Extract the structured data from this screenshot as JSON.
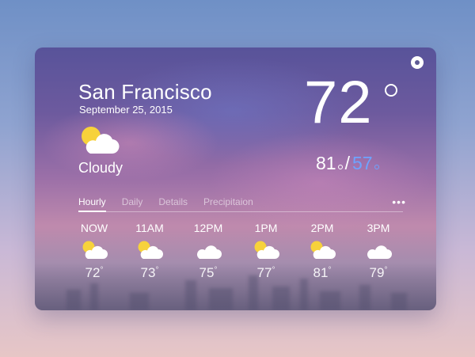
{
  "location": {
    "city": "San Francisco",
    "date": "September 25, 2015"
  },
  "current": {
    "condition": "Cloudy",
    "icon": "partly-cloudy-icon",
    "temperature": "72",
    "high": "81",
    "low": "57"
  },
  "tabs": [
    {
      "label": "Hourly",
      "active": true
    },
    {
      "label": "Daily",
      "active": false
    },
    {
      "label": "Details",
      "active": false
    },
    {
      "label": "Precipitaion",
      "active": false
    }
  ],
  "more_label": "•••",
  "hourly": [
    {
      "time": "NOW",
      "icon": "partly-cloudy-icon",
      "temp": "72"
    },
    {
      "time": "11AM",
      "icon": "partly-cloudy-icon",
      "temp": "73"
    },
    {
      "time": "12PM",
      "icon": "cloud-icon",
      "temp": "75"
    },
    {
      "time": "1PM",
      "icon": "partly-cloudy-icon",
      "temp": "77"
    },
    {
      "time": "2PM",
      "icon": "partly-cloudy-icon",
      "temp": "81"
    },
    {
      "time": "3PM",
      "icon": "cloud-icon",
      "temp": "79"
    }
  ],
  "colors": {
    "low_temp": "#6ea3ff",
    "sun": "#f7d23b",
    "cloud": "#ffffff"
  }
}
